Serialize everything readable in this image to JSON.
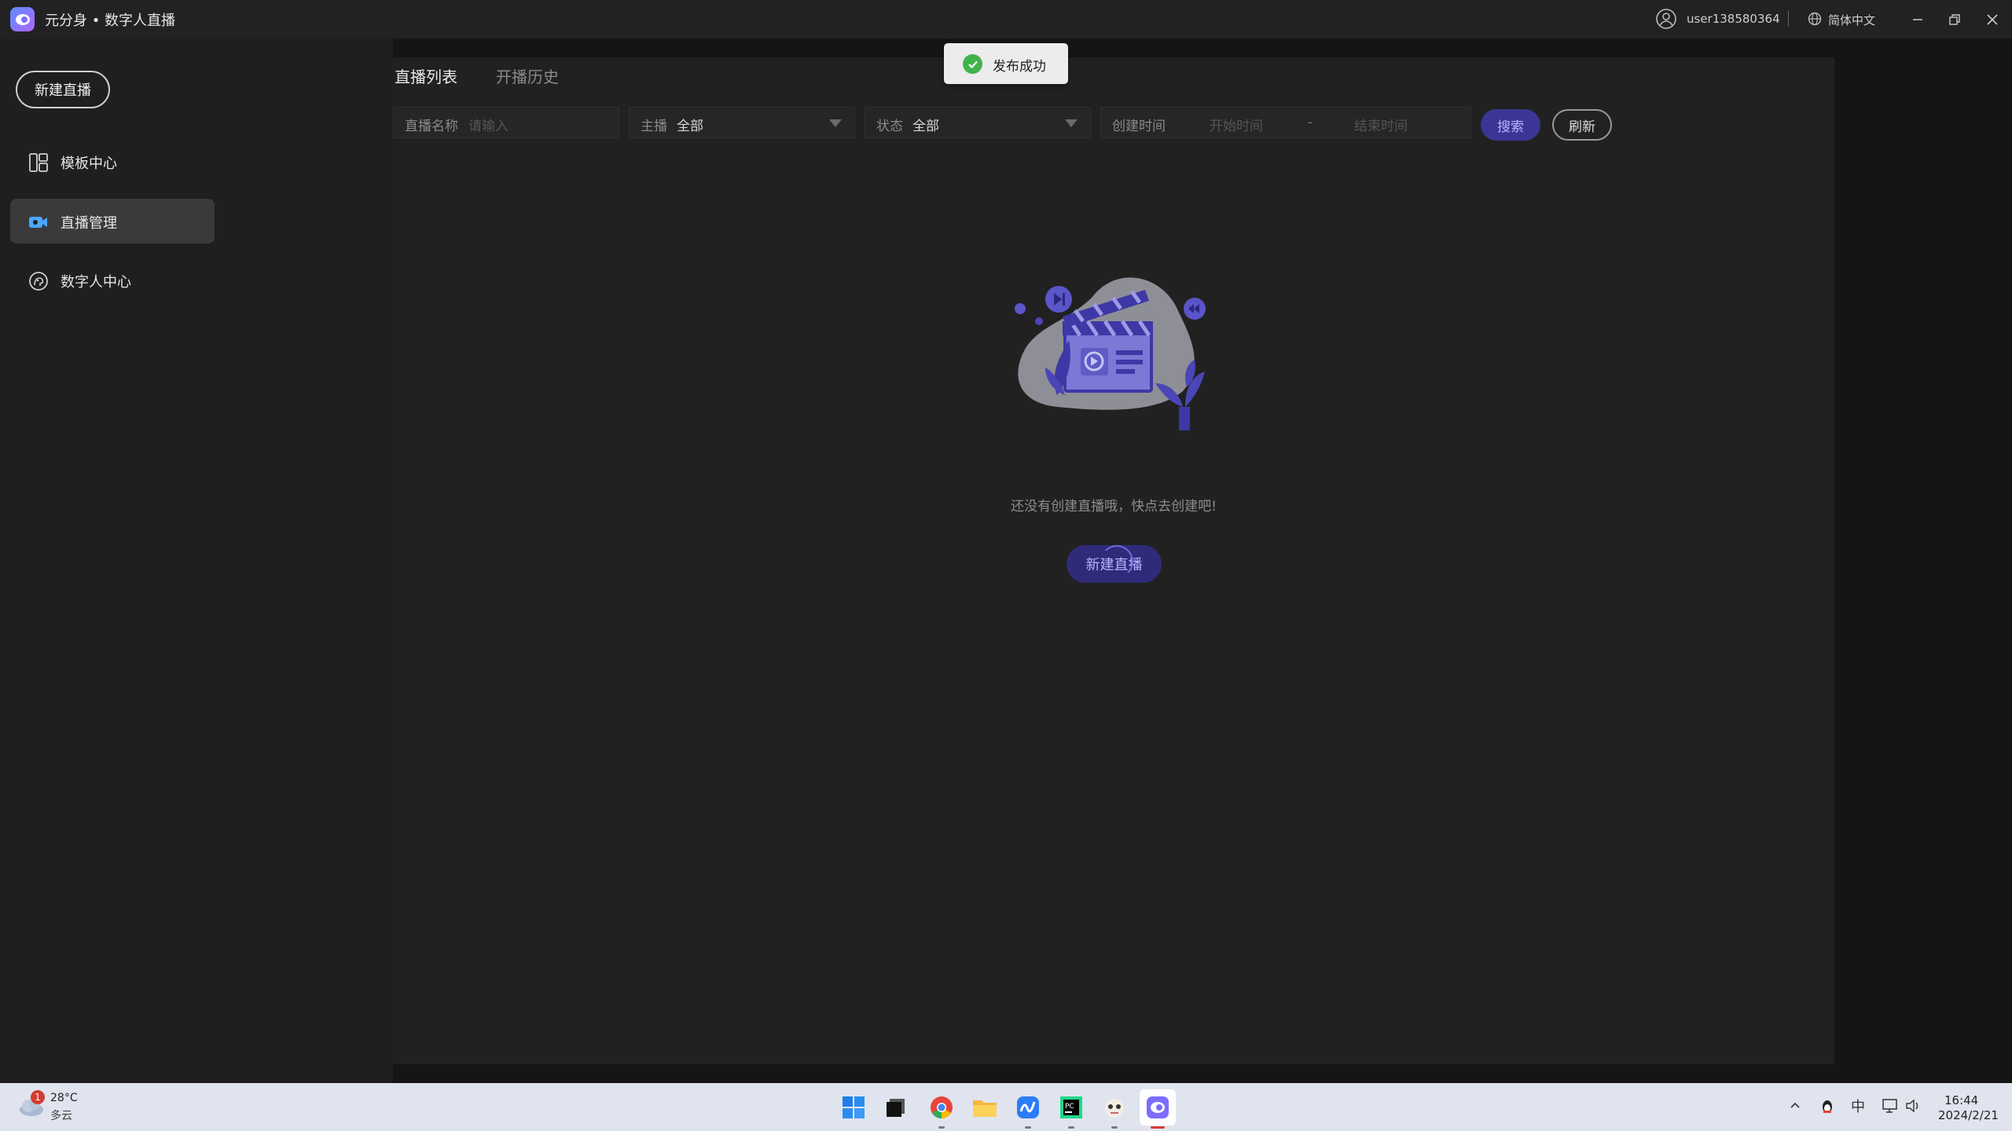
{
  "app": {
    "title": "元分身 • 数字人直播",
    "user": "user138580364",
    "language": "简体中文"
  },
  "sidebar": {
    "new_live_label": "新建直播",
    "items": [
      {
        "label": "模板中心",
        "icon": "template-icon",
        "active": false
      },
      {
        "label": "直播管理",
        "icon": "live-camera-icon",
        "active": true
      },
      {
        "label": "数字人中心",
        "icon": "avatar-head-icon",
        "active": false
      }
    ]
  },
  "main": {
    "tabs": [
      {
        "label": "直播列表",
        "active": true
      },
      {
        "label": "开播历史",
        "active": false
      }
    ],
    "filters": {
      "name_label": "直播名称",
      "name_placeholder": "请输入",
      "host_label": "主播",
      "host_value": "全部",
      "status_label": "状态",
      "status_value": "全部",
      "created_label": "创建时间",
      "start_placeholder": "开始时间",
      "range_sep": "-",
      "end_placeholder": "结束时间"
    },
    "search_label": "搜索",
    "refresh_label": "刷新",
    "empty": {
      "message": "还没有创建直播哦，快点去创建吧!",
      "button_label": "新建直播"
    }
  },
  "toast": {
    "message": "发布成功"
  },
  "taskbar": {
    "weather": {
      "badge": "1",
      "temp": "28°C",
      "desc": "多云"
    },
    "tray_ime": "中",
    "time": "16:44",
    "date": "2024/2/21"
  },
  "colors": {
    "accent": "#3b3696",
    "background": "#151515",
    "panel": "#212121",
    "success": "#41b34a"
  }
}
